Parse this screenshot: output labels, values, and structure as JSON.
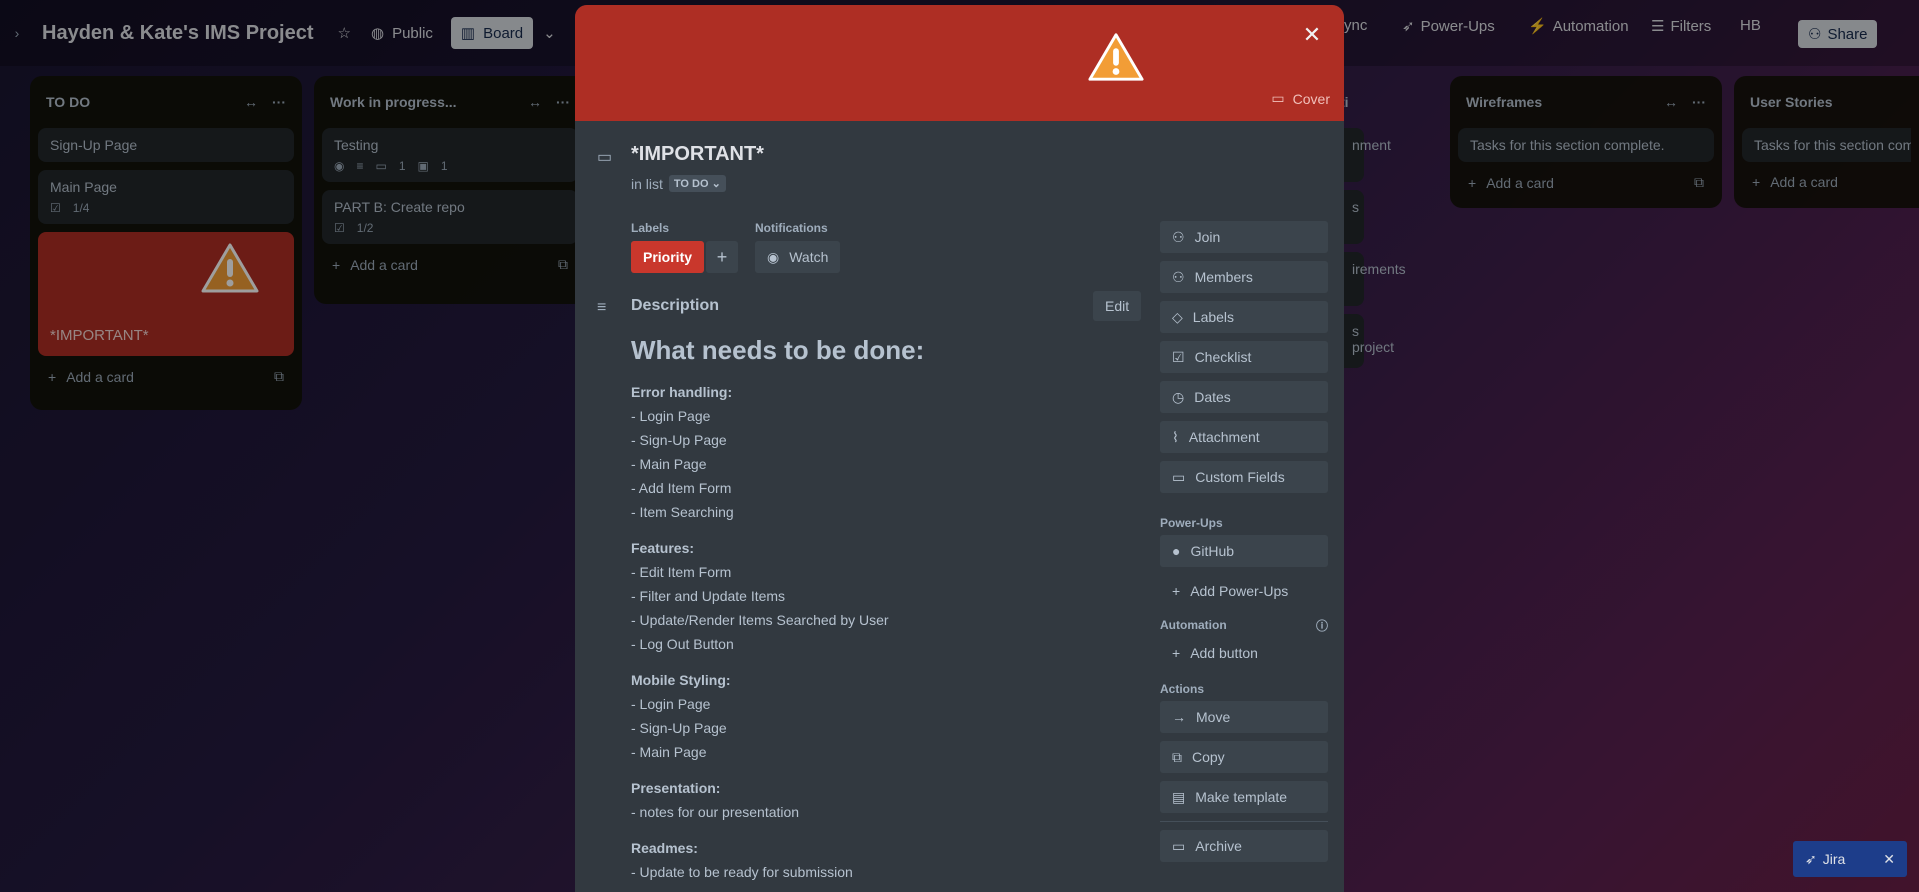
{
  "board": {
    "title": "Hayden & Kate's IMS Project",
    "visibility": "Public",
    "view": "Board",
    "right_items": {
      "sync": "ync",
      "powerups": "Power-Ups",
      "automation": "Automation",
      "filters": "Filters",
      "avatar_initials": "HB",
      "share": "Share"
    }
  },
  "lists": [
    {
      "title": "TO DO",
      "cards": [
        {
          "title": "Sign-Up Page"
        },
        {
          "title": "Main Page",
          "checklist": "1/4"
        }
      ],
      "cover_card_title": "*IMPORTANT*",
      "add_card": "Add a card"
    },
    {
      "title": "Work in progress...",
      "cards": [
        {
          "title": "Testing",
          "comments": "1",
          "attachments": "1"
        },
        {
          "title": "PART B: Create repo",
          "checklist": "1/2"
        }
      ],
      "add_card": "Add a card"
    },
    {
      "title": "ti",
      "partial_cards": [
        "nment",
        "s",
        "irements",
        "s project"
      ]
    },
    {
      "title": "Wireframes",
      "cards": [
        {
          "title": "Tasks for this section complete."
        }
      ],
      "add_card": "Add a card"
    },
    {
      "title": "User Stories",
      "cards": [
        {
          "title": "Tasks for this section com"
        }
      ],
      "add_card": "Add a card"
    }
  ],
  "modal": {
    "cover_label": "Cover",
    "title": "*IMPORTANT*",
    "in_list_prefix": "in list",
    "in_list_value": "TO DO",
    "labels_heading": "Labels",
    "label": "Priority",
    "label_color": "#c9372c",
    "notifications_heading": "Notifications",
    "watch": "Watch",
    "description_heading": "Description",
    "edit": "Edit",
    "description": {
      "heading": "What needs to be done:",
      "groups": [
        {
          "title": "Error handling:",
          "items": [
            "- Login Page",
            "- Sign-Up Page",
            "- Main Page",
            "- Add Item Form",
            "- Item Searching"
          ]
        },
        {
          "title": "Features:",
          "items": [
            "- Edit Item Form",
            "- Filter and Update Items",
            "- Update/Render Items Searched by User",
            "- Log Out Button"
          ]
        },
        {
          "title": "Mobile Styling:",
          "items": [
            "- Login Page",
            "- Sign-Up Page",
            "- Main Page"
          ]
        },
        {
          "title": "Presentation:",
          "items": [
            "- notes for our presentation"
          ]
        },
        {
          "title": "Readmes:",
          "items": [
            "- Update to be ready for submission"
          ]
        }
      ]
    },
    "sidebar": {
      "add_to_card": [
        "Join",
        "Members",
        "Labels",
        "Checklist",
        "Dates",
        "Attachment",
        "Custom Fields"
      ],
      "powerups_heading": "Power-Ups",
      "github": "GitHub",
      "add_powerups": "Add Power-Ups",
      "automation_heading": "Automation",
      "add_button": "Add button",
      "actions_heading": "Actions",
      "actions": [
        "Move",
        "Copy",
        "Make template",
        "Archive"
      ]
    }
  },
  "jira": {
    "label": "Jira"
  },
  "colors": {
    "cover_red": "#ae2e24",
    "modal_bg": "#323940"
  }
}
